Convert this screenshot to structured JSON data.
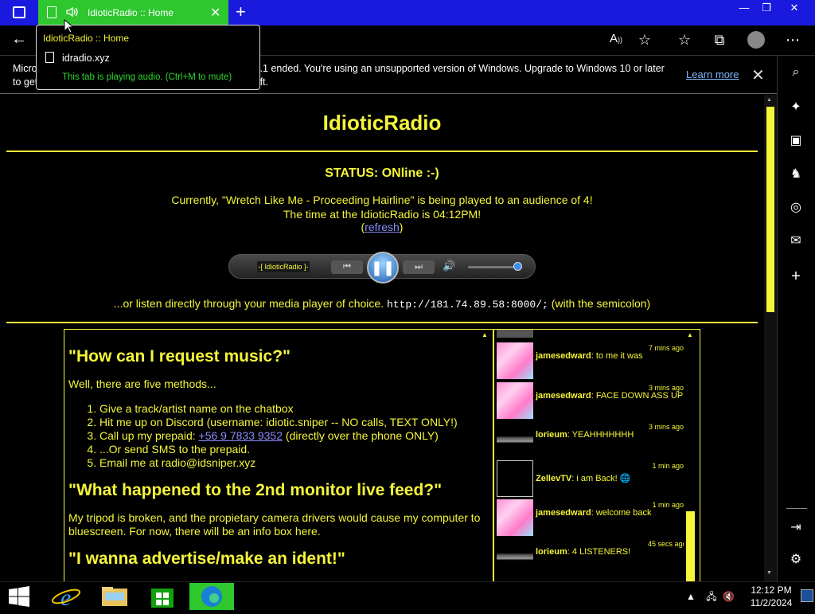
{
  "browser": {
    "tab_title": "IdioticRadio :: Home",
    "tooltip": {
      "title": "IdioticRadio :: Home",
      "domain": "idradio.xyz",
      "audio_note": "This tab is playing audio. (Ctrl+M to mute)"
    },
    "window_controls": {
      "minimize": "—",
      "restore": "❐",
      "close": "✕"
    }
  },
  "infobar": {
    "message": "Microsoft Edge support for Windows 7 and Windows 8/8.1 ended. You're using an unsupported version of Windows. Upgrade to Windows 10 or later to get regular feature and security updates from Microsoft.",
    "learn_more": "Learn more"
  },
  "page": {
    "title": "IdioticRadio",
    "status": "STATUS: ONline :-)",
    "now_playing": "Currently, \"Wretch Like Me - Proceeding Hairline\" is being played to an audience of 4!",
    "time_line": "The time at the IdioticRadio is 04:12PM!",
    "refresh_open": "(",
    "refresh": "refresh",
    "refresh_close": ")",
    "player_label": "-[ IdioticRadio ]-",
    "listen_prefix": "...or listen directly through your media player of choice.",
    "stream_url": "http://181.74.89.58:8000/;",
    "listen_suffix": "(with the semicolon)",
    "volume_level": 0.92
  },
  "faq": {
    "q1": "\"How can I request music?\"",
    "q1_intro": "Well, there are five methods...",
    "methods": [
      "Give a track/artist name on the chatbox",
      "Hit me up on Discord (username: idiotic.sniper -- NO calls, TEXT ONLY!)",
      "Call up my prepaid:",
      "...Or send SMS to the prepaid.",
      "Email me at radio@idsniper.xyz"
    ],
    "phone": "+56 9 7833 9352",
    "phone_suffix": "(directly over the phone ONLY)",
    "q2": "\"What happened to the 2nd monitor live feed?\"",
    "q2_answer": "My tripod is broken, and the propietary camera drivers would cause my computer to bluescreen. For now, there will be an info box here.",
    "q3": "\"I wanna advertise/make an ident!\""
  },
  "chat": {
    "messages": [
      {
        "user": "jamesedward",
        "text": ": to me it was",
        "time": "7 mins ago"
      },
      {
        "user": "jamesedward",
        "text": ": FACE DOWN ASS UP",
        "time": "3 mins ago"
      },
      {
        "user": "lorieum",
        "text": ": YEAHHHHHHH",
        "time": "3 mins ago"
      },
      {
        "user": "ZellevTV",
        "text": ": i am Back!",
        "time": "1 min ago"
      },
      {
        "user": "jamesedward",
        "text": ": welcome back",
        "time": "1 min ago"
      },
      {
        "user": "lorieum",
        "text": ": 4 LISTENERS!",
        "time": "45 secs ago"
      }
    ]
  },
  "taskbar": {
    "time": "12:12 PM",
    "date": "11/2/2024"
  },
  "colors": {
    "accent": "#f5f53a",
    "tab": "#2ec72e",
    "titlebar": "#1a1adf"
  }
}
